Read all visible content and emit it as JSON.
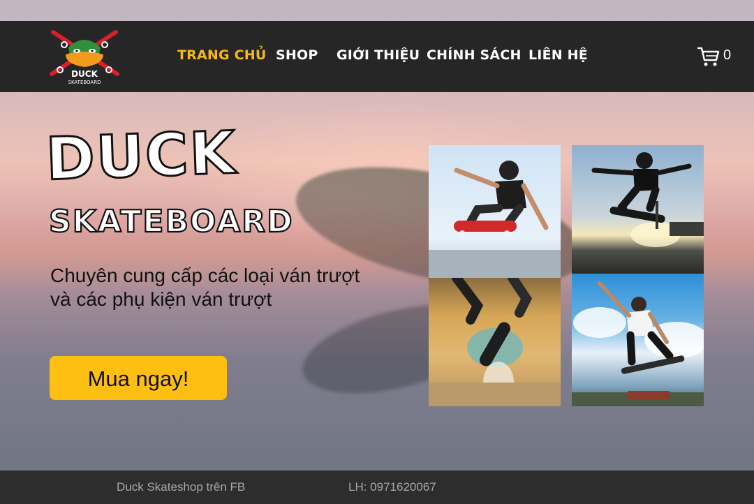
{
  "brand": {
    "logo_text": "DUCK",
    "logo_subtext": "SKATEBOARD"
  },
  "nav": {
    "items": [
      {
        "label": "TRANG CHỦ",
        "active": true
      },
      {
        "label": "SHOP",
        "active": false
      },
      {
        "label": "GIỚI THIỆU",
        "active": false
      },
      {
        "label": "CHÍNH SÁCH",
        "active": false
      },
      {
        "label": "LIÊN HỆ",
        "active": false
      }
    ],
    "cart_icon": "shopping-cart-icon",
    "cart_count": "0"
  },
  "hero": {
    "title": "DUCK",
    "subtitle": "SKATEBOARD",
    "tagline_line1": "Chuyên cung cấp các loại ván trượt",
    "tagline_line2": "và các phụ kiện ván trượt",
    "cta_label": "Mua ngay!"
  },
  "footer": {
    "facebook_text": "Duck Skateshop trên FB",
    "phone_text": "LH: 0971620067"
  },
  "colors": {
    "nav_bg": "#262626",
    "active_nav": "#f6b71a",
    "cta_bg": "#fdbf12",
    "footer_bg": "#2d2d2d",
    "footer_text": "#a7a7a7"
  }
}
